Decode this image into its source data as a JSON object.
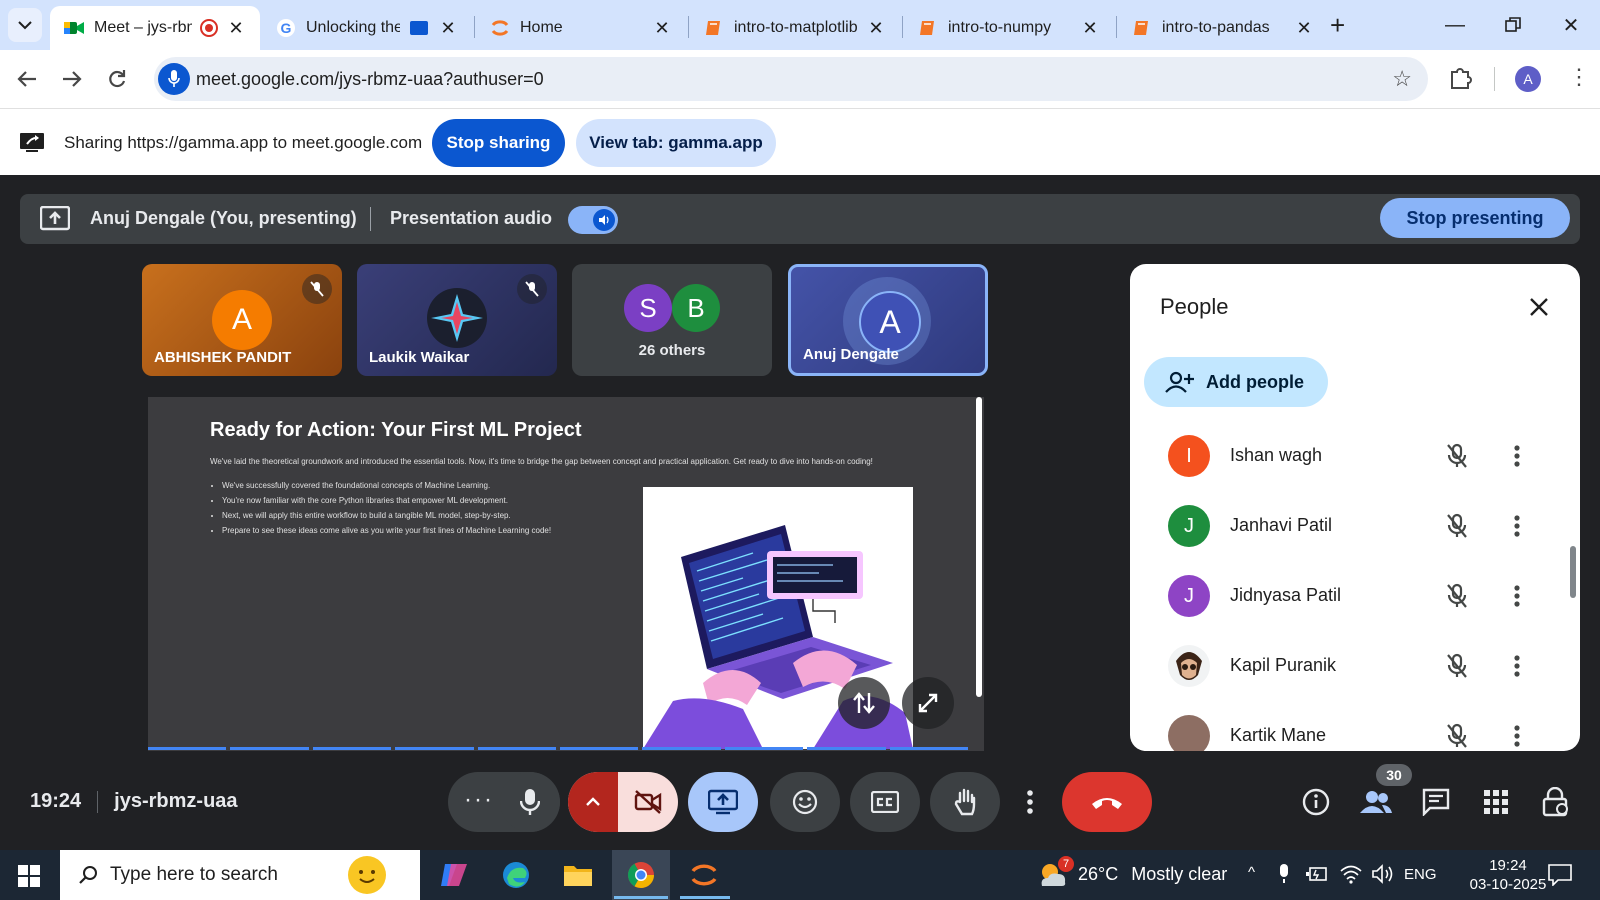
{
  "browser": {
    "tabs": [
      {
        "title": "Meet – jys-rbmz-uaa",
        "icon": "google-meet-icon",
        "active": true,
        "recording": true
      },
      {
        "title": "Unlocking the",
        "icon": "google-g-icon",
        "active": false,
        "casting": true
      },
      {
        "title": "Home",
        "icon": "jupyter-icon",
        "active": false
      },
      {
        "title": "intro-to-matplotlib",
        "icon": "notebook-icon",
        "active": false
      },
      {
        "title": "intro-to-numpy",
        "icon": "notebook-icon",
        "active": false
      },
      {
        "title": "intro-to-pandas",
        "icon": "notebook-icon",
        "active": false
      }
    ],
    "url": "meet.google.com/jys-rbmz-uaa?authuser=0",
    "profile_initial": "A"
  },
  "sharing_bar": {
    "text": "Sharing https://gamma.app to meet.google.com",
    "stop_label": "Stop sharing",
    "view_tab_label": "View tab: gamma.app"
  },
  "presenting_bar": {
    "presenter": "Anuj Dengale (You, presenting)",
    "audio_label": "Presentation audio",
    "audio_on": true,
    "stop_label": "Stop presenting"
  },
  "tiles": [
    {
      "name": "ABHISHEK PANDIT",
      "initial": "A",
      "muted": true
    },
    {
      "name": "Laukik Waikar",
      "muted": true
    },
    {
      "initials": [
        "S",
        "B"
      ],
      "label": "26 others"
    },
    {
      "name": "Anuj Dengale",
      "initial": "A"
    }
  ],
  "slide": {
    "title": "Ready for Action: Your First ML Project",
    "intro": "We've laid the theoretical groundwork and introduced the essential tools. Now, it's time to bridge the gap between concept and practical application. Get ready to dive into hands-on coding!",
    "bullets": [
      "We've successfully covered the foundational concepts of Machine Learning.",
      "You're now familiar with the core Python libraries that empower ML development.",
      "Next, we will apply this entire workflow to build a tangible ML model, step-by-step.",
      "Prepare to see these ideas come alive as you write your first lines of Machine Learning code!"
    ]
  },
  "people_panel": {
    "title": "People",
    "add_label": "Add people",
    "participants": [
      {
        "name": "Ishan wagh",
        "initial": "I",
        "color": "#f4511e"
      },
      {
        "name": "Janhavi Patil",
        "initial": "J",
        "color": "#1e8e3e"
      },
      {
        "name": "Jidnyasa Patil",
        "initial": "J",
        "color": "#8e44c5"
      },
      {
        "name": "Kapil Puranik",
        "avatar": "photo"
      },
      {
        "name": "Kartik Mane",
        "avatar": "photo"
      }
    ]
  },
  "meeting": {
    "time": "19:24",
    "code": "jys-rbmz-uaa",
    "participant_count": "30"
  },
  "taskbar": {
    "search_placeholder": "Type here to search",
    "weather_temp": "26°C",
    "weather_desc": "Mostly clear",
    "weather_badge": "7",
    "language": "ENG",
    "time": "19:24",
    "date": "03-10-2025"
  },
  "colors": {
    "meet_red": "#ea4335",
    "meet_blue": "#0b57d0",
    "accent_light_blue": "#8ab4f8",
    "tile_orange": "#b35a12",
    "tile_navy": "#2d3260"
  }
}
